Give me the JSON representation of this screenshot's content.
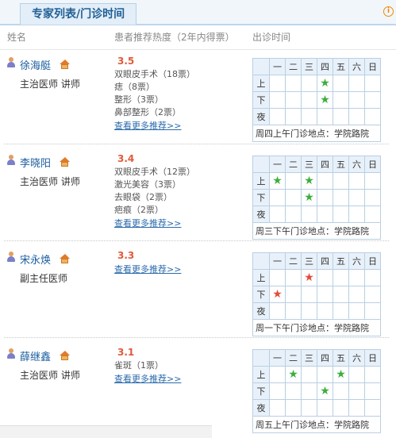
{
  "header": {
    "tab_title": "专家列表/门诊时间",
    "info_icon": "i"
  },
  "columns": {
    "name": "姓名",
    "recommend": "患者推荐热度（2年内得票）",
    "schedule": "出诊时间"
  },
  "schedule_header": [
    "一",
    "二",
    "三",
    "四",
    "五",
    "六",
    "日"
  ],
  "row_labels": [
    "上",
    "下",
    "夜"
  ],
  "doctors": [
    {
      "name": "徐海艇",
      "title": "主治医师 讲师",
      "score": "3.5",
      "recommendations": [
        "双眼皮手术（18票）",
        "痣（8票）",
        "整形（3票）",
        "鼻部整形（2票）"
      ],
      "more": "查看更多推荐>>",
      "note": "周四上午门诊地点：学院路院"
    },
    {
      "name": "李晓阳",
      "title": "主治医师 讲师",
      "score": "3.4",
      "recommendations": [
        "双眼皮手术（12票）",
        "激光美容（3票）",
        "去眼袋（2票）",
        "疤痕（2票）"
      ],
      "more": "查看更多推荐>>",
      "note": "周三下午门诊地点：学院路院"
    },
    {
      "name": "宋永焕",
      "title": "副主任医师",
      "score": "3.3",
      "recommendations": [],
      "more": "查看更多推荐>>",
      "note": "周一下午门诊地点：学院路院"
    },
    {
      "name": "薛继鑫",
      "title": "主治医师 讲师",
      "score": "3.1",
      "recommendations": [
        "雀斑（1票）"
      ],
      "more": "查看更多推荐>>",
      "note": "周五上午门诊地点：学院路院"
    }
  ],
  "schedules": [
    {
      "color": "green",
      "slots": [
        [
          0,
          3
        ],
        [
          1,
          3
        ]
      ]
    },
    {
      "color": "green",
      "slots": [
        [
          0,
          0
        ],
        [
          0,
          2
        ],
        [
          1,
          2
        ]
      ]
    },
    {
      "color": "red",
      "slots": [
        [
          0,
          2
        ],
        [
          1,
          0
        ]
      ]
    },
    {
      "color": "green",
      "slots": [
        [
          0,
          1
        ],
        [
          0,
          4
        ],
        [
          1,
          3
        ]
      ]
    }
  ],
  "colors": {
    "accent": "#1d5fa0",
    "score": "#e05a3a",
    "green_star": "#3cae3c",
    "red_star": "#e34b3b",
    "grid": "#b9cfe3"
  }
}
